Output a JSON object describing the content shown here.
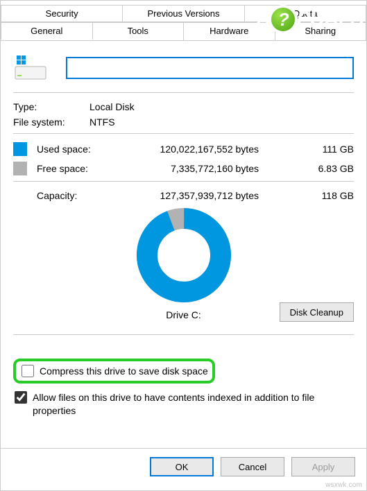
{
  "tabs": {
    "row1": [
      {
        "label": "Security"
      },
      {
        "label": "Previous Versions"
      },
      {
        "label": "Quota"
      }
    ],
    "row2": [
      {
        "label": "General",
        "active": true
      },
      {
        "label": "Tools"
      },
      {
        "label": "Hardware"
      },
      {
        "label": "Sharing"
      }
    ]
  },
  "driveNameValue": "",
  "fields": {
    "typeLabel": "Type:",
    "typeValue": "Local Disk",
    "fsLabel": "File system:",
    "fsValue": "NTFS"
  },
  "space": {
    "usedLabel": "Used space:",
    "usedBytes": "120,022,167,552 bytes",
    "usedHuman": "111 GB",
    "freeLabel": "Free space:",
    "freeBytes": "7,335,772,160 bytes",
    "freeHuman": "6.83 GB",
    "capacityLabel": "Capacity:",
    "capacityBytes": "127,357,939,712 bytes",
    "capacityHuman": "118 GB"
  },
  "chart_data": {
    "type": "pie",
    "title": "Drive C:",
    "series": [
      {
        "name": "Used space",
        "value": 120022167552,
        "color": "#0096e0"
      },
      {
        "name": "Free space",
        "value": 7335772160,
        "color": "#b2b2b2"
      }
    ],
    "total": 127357939712
  },
  "diskCleanup": "Disk Cleanup",
  "compress": {
    "checked": false,
    "label": "Compress this drive to save disk space"
  },
  "index": {
    "checked": true,
    "label": "Allow files on this drive to have contents indexed in addition to file properties"
  },
  "buttons": {
    "ok": "OK",
    "cancel": "Cancel",
    "apply": "Apply"
  },
  "watermark": "wsxwk.com",
  "brand": {
    "part1": "A",
    "circle": "?",
    "part2": "PUALS"
  },
  "colors": {
    "accent": "#0078d7",
    "used": "#0096e0",
    "free": "#b2b2b2",
    "highlight": "#28cc28"
  }
}
